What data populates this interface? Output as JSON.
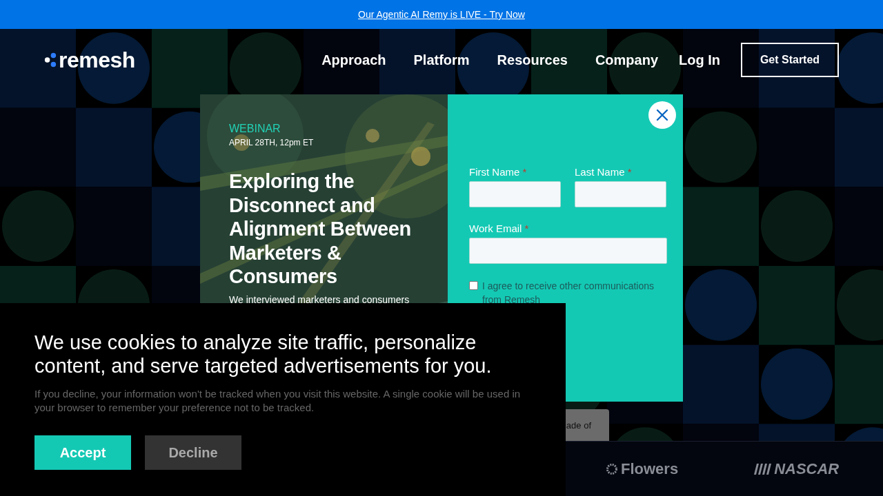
{
  "announcement": {
    "link": "Our Agentic AI Remy is LIVE - Try Now"
  },
  "header": {
    "logo": "remesh",
    "nav": [
      {
        "label": "Approach"
      },
      {
        "label": "Platform"
      },
      {
        "label": "Resources"
      },
      {
        "label": "Company"
      }
    ],
    "login": "Log In",
    "cta": "Get Started"
  },
  "modal": {
    "kind": "picture",
    "eyebrow": "WEBINAR",
    "date": "APRIL 28TH, 12pm ET",
    "title": "Exploring the Disconnect and Alignment Between Marketers & Consumers",
    "description": "We interviewed marketers and consumers",
    "fields": [
      {
        "label": "First Name",
        "mark": "*"
      },
      {
        "label": "Last Name",
        "mark": "*"
      },
      {
        "label": "Work Email",
        "mark": "*"
      }
    ],
    "consent": {
      "label": "I agree to receive other communications from Remesh",
      "checked": false
    }
  },
  "behind": {
    "card_text": "ade of",
    "logos": [
      "Flowers",
      "NASCAR"
    ]
  },
  "cookie_banner": {
    "heading": "We use cookies to analyze site traffic, personalize content, and serve targeted advertisements for you.",
    "body": "If you decline, your information won't be tracked when you visit this website. A single cookie will be used in your browser to remember your preference not to be tracked.",
    "buttons": [
      {
        "label": "Accept",
        "kind": "primary"
      },
      {
        "label": "Decline",
        "kind": "secondary"
      }
    ]
  }
}
